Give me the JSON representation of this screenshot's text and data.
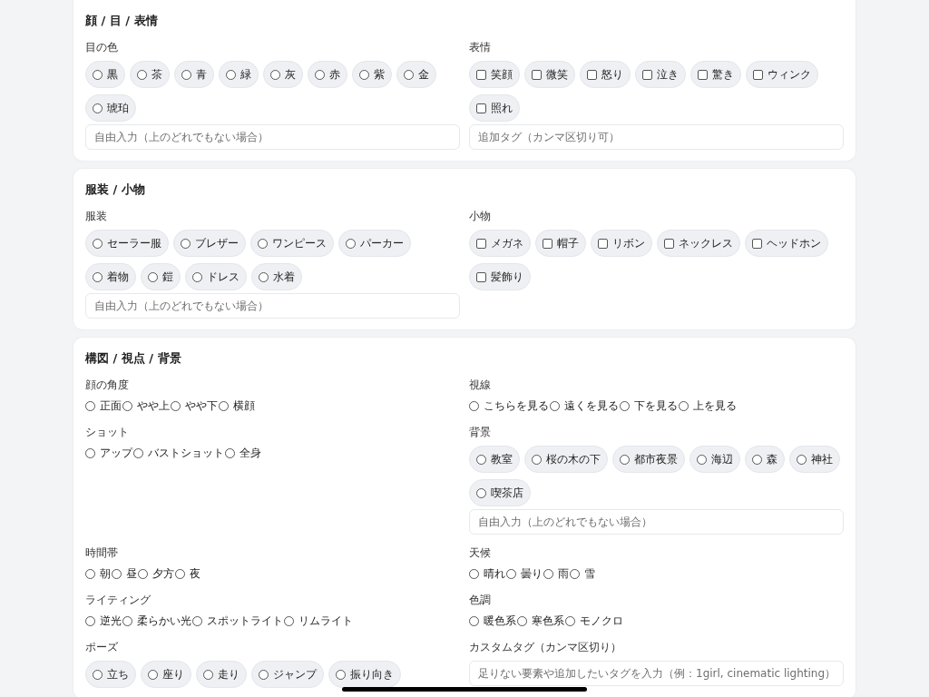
{
  "sections": [
    {
      "title": "顔 / 目 / 表情",
      "fields": [
        {
          "label": "目の色",
          "kind": "radio-chips",
          "options": [
            {
              "label": "黒",
              "selected": false
            },
            {
              "label": "茶",
              "selected": false
            },
            {
              "label": "青",
              "selected": false
            },
            {
              "label": "緑",
              "selected": false
            },
            {
              "label": "灰",
              "selected": false
            },
            {
              "label": "赤",
              "selected": false
            },
            {
              "label": "紫",
              "selected": false
            },
            {
              "label": "金",
              "selected": false
            },
            {
              "label": "琥珀",
              "selected": false
            }
          ],
          "placeholder": "自由入力（上のどれでもない場合）"
        },
        {
          "label": "表情",
          "kind": "checkbox-chips",
          "options": [
            {
              "label": "笑顔",
              "selected": false
            },
            {
              "label": "微笑",
              "selected": false
            },
            {
              "label": "怒り",
              "selected": false
            },
            {
              "label": "泣き",
              "selected": false
            },
            {
              "label": "驚き",
              "selected": false
            },
            {
              "label": "ウィンク",
              "selected": false
            },
            {
              "label": "照れ",
              "selected": false
            }
          ],
          "placeholder": "追加タグ（カンマ区切り可）"
        }
      ]
    },
    {
      "title": "服装 / 小物",
      "fields": [
        {
          "label": "服装",
          "kind": "radio-chips",
          "options": [
            {
              "label": "セーラー服",
              "selected": false
            },
            {
              "label": "ブレザー",
              "selected": false
            },
            {
              "label": "ワンピース",
              "selected": false
            },
            {
              "label": "パーカー",
              "selected": false
            },
            {
              "label": "着物",
              "selected": false
            },
            {
              "label": "鎧",
              "selected": false
            },
            {
              "label": "ドレス",
              "selected": false
            },
            {
              "label": "水着",
              "selected": false
            }
          ],
          "placeholder": "自由入力（上のどれでもない場合）"
        },
        {
          "label": "小物",
          "kind": "checkbox-chips",
          "options": [
            {
              "label": "メガネ",
              "selected": false
            },
            {
              "label": "帽子",
              "selected": false
            },
            {
              "label": "リボン",
              "selected": false
            },
            {
              "label": "ネックレス",
              "selected": false
            },
            {
              "label": "ヘッドホン",
              "selected": false
            },
            {
              "label": "髪飾り",
              "selected": false
            }
          ]
        }
      ]
    },
    {
      "title": "構図 / 視点 / 背景",
      "fields": [
        {
          "label": "顔の角度",
          "kind": "radio-inline",
          "options": [
            {
              "label": "正面",
              "selected": false
            },
            {
              "label": "やや上",
              "selected": false
            },
            {
              "label": "やや下",
              "selected": false
            },
            {
              "label": "横顔",
              "selected": false
            }
          ]
        },
        {
          "label": "視線",
          "kind": "radio-inline",
          "options": [
            {
              "label": "こちらを見る",
              "selected": false
            },
            {
              "label": "遠くを見る",
              "selected": false
            },
            {
              "label": "下を見る",
              "selected": false
            },
            {
              "label": "上を見る",
              "selected": false
            }
          ]
        },
        {
          "label": "ショット",
          "kind": "radio-inline",
          "options": [
            {
              "label": "アップ",
              "selected": false
            },
            {
              "label": "バストショット",
              "selected": false
            },
            {
              "label": "全身",
              "selected": false
            }
          ]
        },
        {
          "label": "背景",
          "kind": "radio-chips",
          "options": [
            {
              "label": "教室",
              "selected": false
            },
            {
              "label": "桜の木の下",
              "selected": false
            },
            {
              "label": "都市夜景",
              "selected": false
            },
            {
              "label": "海辺",
              "selected": false
            },
            {
              "label": "森",
              "selected": false
            },
            {
              "label": "神社",
              "selected": false
            },
            {
              "label": "喫茶店",
              "selected": false
            }
          ],
          "placeholder": "自由入力（上のどれでもない場合）"
        },
        {
          "label": "時間帯",
          "kind": "radio-inline",
          "options": [
            {
              "label": "朝",
              "selected": false
            },
            {
              "label": "昼",
              "selected": false
            },
            {
              "label": "夕方",
              "selected": false
            },
            {
              "label": "夜",
              "selected": false
            }
          ]
        },
        {
          "label": "天候",
          "kind": "radio-inline",
          "options": [
            {
              "label": "晴れ",
              "selected": false
            },
            {
              "label": "曇り",
              "selected": false
            },
            {
              "label": "雨",
              "selected": false
            },
            {
              "label": "雪",
              "selected": false
            }
          ]
        },
        {
          "label": "ライティング",
          "kind": "radio-inline",
          "options": [
            {
              "label": "逆光",
              "selected": false
            },
            {
              "label": "柔らかい光",
              "selected": false
            },
            {
              "label": "スポットライト",
              "selected": false
            },
            {
              "label": "リムライト",
              "selected": false
            }
          ]
        },
        {
          "label": "色調",
          "kind": "radio-inline",
          "options": [
            {
              "label": "暖色系",
              "selected": false
            },
            {
              "label": "寒色系",
              "selected": false
            },
            {
              "label": "モノクロ",
              "selected": false
            }
          ]
        },
        {
          "label": "ポーズ",
          "kind": "radio-chips",
          "options": [
            {
              "label": "立ち",
              "selected": false
            },
            {
              "label": "座り",
              "selected": false
            },
            {
              "label": "走り",
              "selected": false
            },
            {
              "label": "ジャンプ",
              "selected": false
            },
            {
              "label": "振り向き",
              "selected": false
            }
          ]
        },
        {
          "label": "カスタムタグ（カンマ区切り）",
          "kind": "input",
          "placeholder": "足りない要素や追加したいタグを入力（例：1girl, cinematic lighting）"
        }
      ]
    }
  ]
}
